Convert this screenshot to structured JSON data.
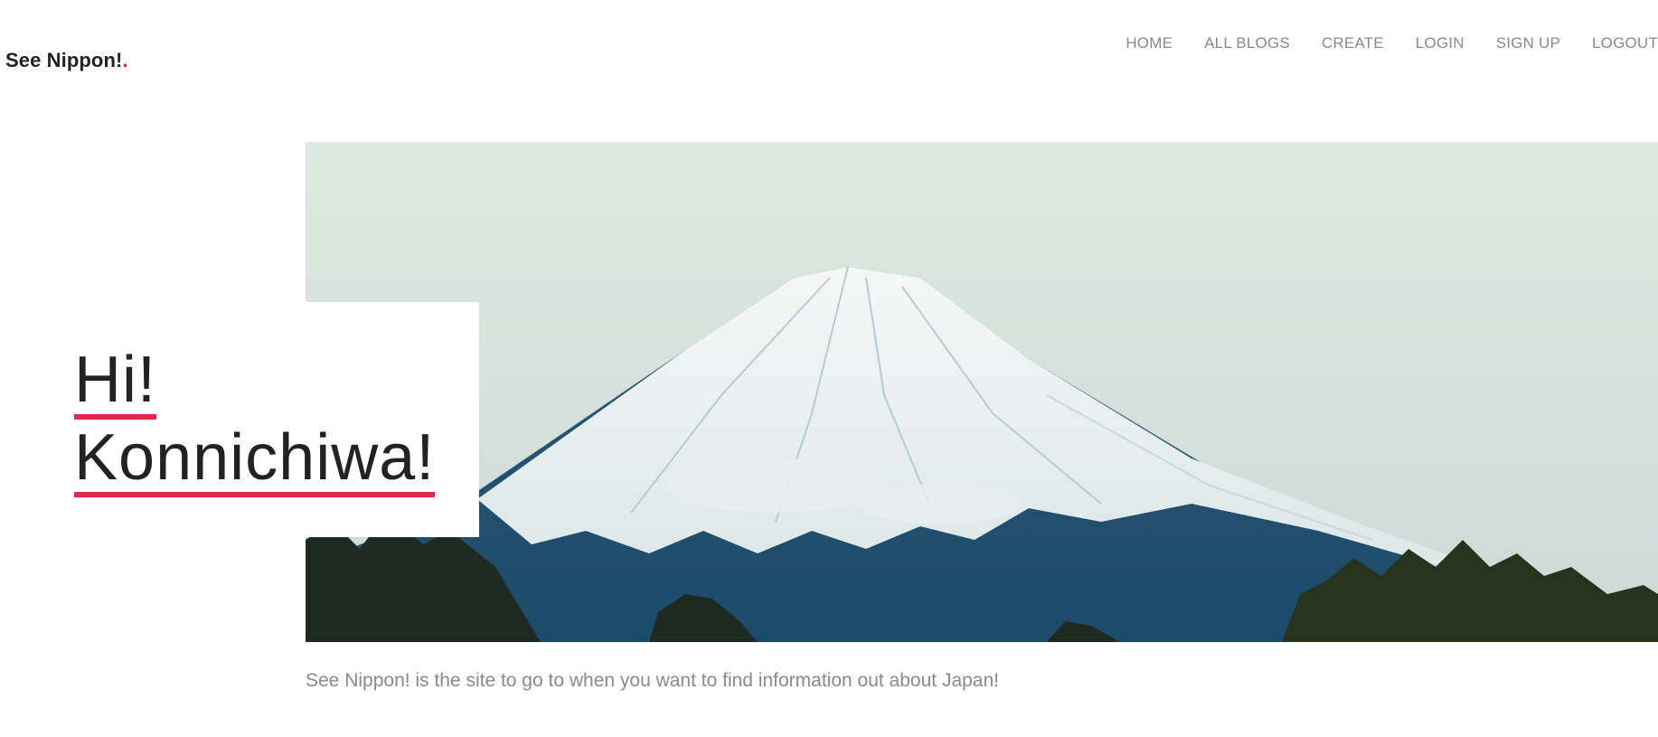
{
  "header": {
    "logo_text": "See Nippon!",
    "logo_dot": ".",
    "nav": [
      {
        "label": "HOME"
      },
      {
        "label": "ALL BLOGS"
      },
      {
        "label": "CREATE"
      },
      {
        "label": "LOGIN"
      },
      {
        "label": "SIGN UP"
      },
      {
        "label": "LOGOUT"
      }
    ]
  },
  "hero": {
    "title_line1": "Hi!",
    "title_line2": "Konnichiwa!",
    "image_subject": "snow-capped mountain",
    "accent_color": "#e0294e"
  },
  "intro": {
    "text": "See Nippon! is the site to go to when you want to find information out about Japan!"
  }
}
